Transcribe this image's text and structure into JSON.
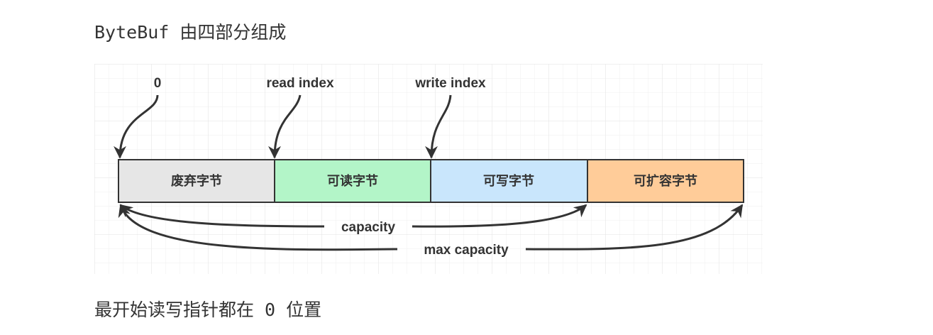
{
  "heading": "ByteBuf 由四部分组成",
  "footer": "最开始读写指针都在 0 位置",
  "diagram": {
    "pointers": [
      {
        "name": "zero",
        "label": "0"
      },
      {
        "name": "read-index",
        "label": "read index"
      },
      {
        "name": "write-index",
        "label": "write index"
      }
    ],
    "segments": [
      {
        "name": "discarded",
        "label": "废弃字节",
        "color": "#e6e6e6"
      },
      {
        "name": "readable",
        "label": "可读字节",
        "color": "#b3f5c8"
      },
      {
        "name": "writable",
        "label": "可写字节",
        "color": "#c9e6fc"
      },
      {
        "name": "expandable",
        "label": "可扩容字节",
        "color": "#ffcc99"
      }
    ],
    "spans": [
      {
        "name": "capacity",
        "label": "capacity"
      },
      {
        "name": "max-capacity",
        "label": "max capacity"
      }
    ]
  }
}
